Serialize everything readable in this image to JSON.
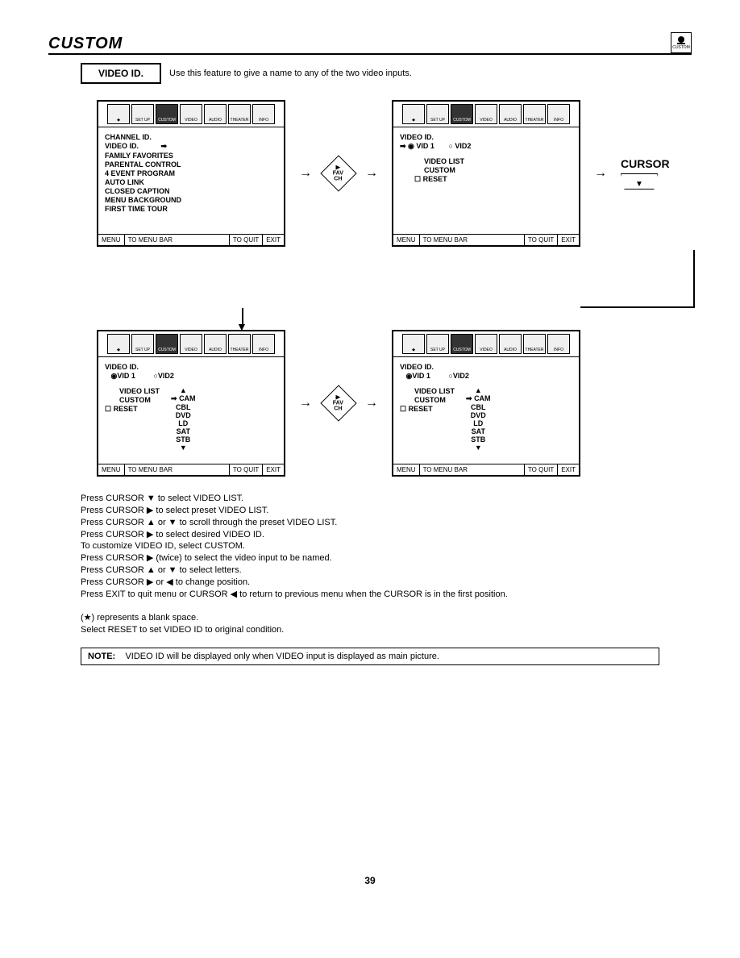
{
  "header": {
    "section_title": "CUSTOM",
    "corner_icon_label": "CUSTOM"
  },
  "feature": {
    "name": "VIDEO ID.",
    "description": "Use this feature to give a name to any of the two video inputs."
  },
  "menubar_icons": [
    "SET UP",
    "CUSTOM",
    "VIDEO",
    "AUDIO",
    "THEATER",
    "INFO"
  ],
  "screen1": {
    "items": [
      "CHANNEL ID.",
      "VIDEO ID.",
      "FAMILY FAVORITES",
      "PARENTAL CONTROL",
      "4 EVENT PROGRAM",
      "AUTO LINK",
      "CLOSED CAPTION",
      "MENU BACKGROUND",
      "FIRST TIME TOUR"
    ],
    "footer": [
      "MENU",
      "TO MENU BAR",
      "TO QUIT",
      "EXIT"
    ]
  },
  "favch_label": "FAV\nCH",
  "screen2": {
    "title": "VIDEO ID.",
    "vid1": "◉ VID 1",
    "vid2": "○ VID2",
    "video_list": "VIDEO LIST",
    "custom": "CUSTOM",
    "reset": "☐  RESET",
    "footer": [
      "MENU",
      "TO MENU BAR",
      "TO QUIT",
      "EXIT"
    ]
  },
  "cursor_label": "CURSOR",
  "screen3": {
    "title": "VIDEO ID.",
    "vid1": "◉VID 1",
    "vid2": "○VID2",
    "video_list": "VIDEO  LIST",
    "custom": "CUSTOM",
    "reset": "☐ RESET",
    "list_items": [
      "▲",
      "CAM",
      "CBL",
      "DVD",
      "LD",
      "SAT",
      "STB",
      "▼"
    ],
    "footer": [
      "MENU",
      "TO MENU BAR",
      "TO QUIT",
      "EXIT"
    ]
  },
  "screen4": {
    "title": "VIDEO ID.",
    "vid1": "◉VID 1",
    "vid2": "○VID2",
    "video_list": "VIDEO  LIST",
    "custom": "CUSTOM",
    "reset": "☐ RESET",
    "list_items": [
      "▲",
      "CAM",
      "CBL",
      "DVD",
      "LD",
      "SAT",
      "STB",
      "▼"
    ],
    "footer": [
      "MENU",
      "TO MENU BAR",
      "TO QUIT",
      "EXIT"
    ]
  },
  "instructions": [
    "Press CURSOR ▼ to select VIDEO LIST.",
    "Press CURSOR ▶ to select preset VIDEO LIST.",
    "Press CURSOR ▲ or ▼ to scroll through the preset VIDEO LIST.",
    "Press CURSOR ▶ to select desired VIDEO ID.",
    "To customize VIDEO ID, select CUSTOM.",
    "Press CURSOR ▶ (twice) to select the video input to be named.",
    "Press CURSOR ▲ or ▼ to select letters.",
    "Press CURSOR ▶ or ◀ to change position.",
    "Press EXIT to quit menu or CURSOR ◀ to return to previous menu when the CURSOR is in the first position."
  ],
  "notes_extra": [
    "(★) represents a blank space.",
    "Select RESET to set VIDEO ID to original condition."
  ],
  "note_box": {
    "label": "NOTE:",
    "text": "VIDEO ID will be displayed only when VIDEO input is displayed as main picture."
  },
  "page_number": "39"
}
